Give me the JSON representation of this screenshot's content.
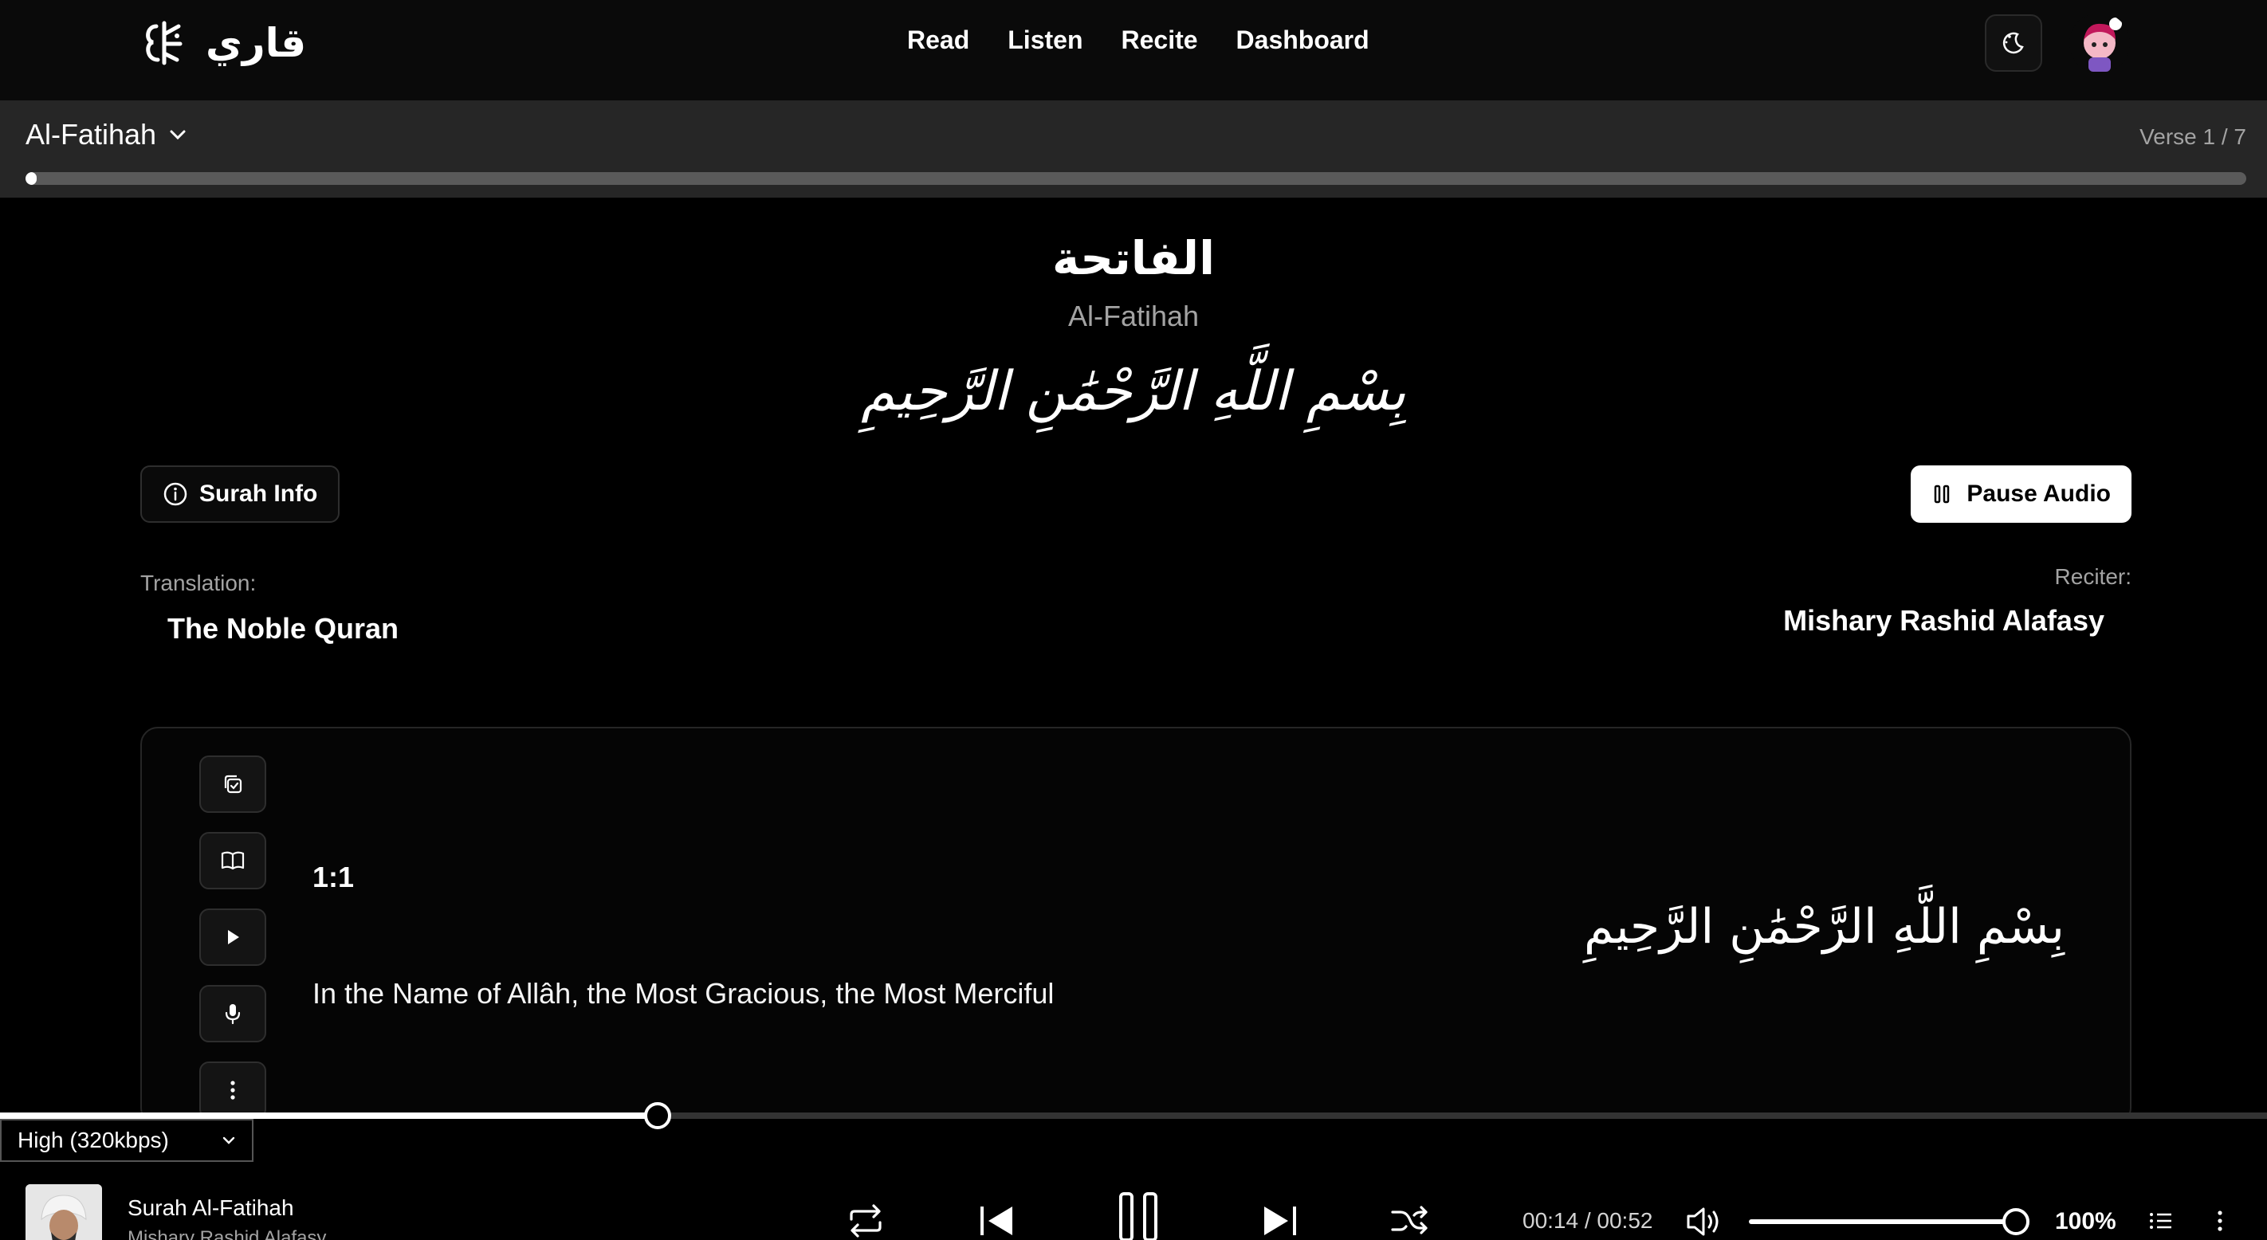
{
  "app": {
    "logo_text": "قاري"
  },
  "nav": {
    "items": [
      "Read",
      "Listen",
      "Recite",
      "Dashboard"
    ]
  },
  "surah_bar": {
    "selected": "Al-Fatihah",
    "verse_counter": "Verse 1 / 7",
    "progress": 0.005
  },
  "header": {
    "arabic_name": "الفاتحة",
    "latin_name": "Al-Fatihah",
    "bismillah": "بِسْمِ اللَّهِ الرَّحْمَٰنِ الرَّحِيمِ"
  },
  "actions": {
    "info_label": "Surah Info",
    "pause_label": "Pause Audio"
  },
  "settings": {
    "translation_label": "Translation:",
    "translation_value": "The Noble Quran",
    "reciter_label": "Reciter:",
    "reciter_value": "Mishary Rashid Alafasy"
  },
  "verse": {
    "key": "1:1",
    "translation": "In the Name of Allâh, the Most Gracious, the Most Merciful",
    "arabic": "بِسْمِ اللَّهِ الرَّحْمَٰنِ الرَّحِيمِ"
  },
  "player": {
    "quality": "High (320kbps)",
    "track_title": "Surah Al-Fatihah",
    "track_artist": "Mishary Rashid Alafasy",
    "time": "00:14 / 00:52",
    "volume": "100%",
    "progress": 0.27,
    "volume_level": 1.0
  },
  "colors": {
    "background": "#000000",
    "surface": "#262626",
    "accent": "#ffffff",
    "muted": "#a3a3a3"
  }
}
